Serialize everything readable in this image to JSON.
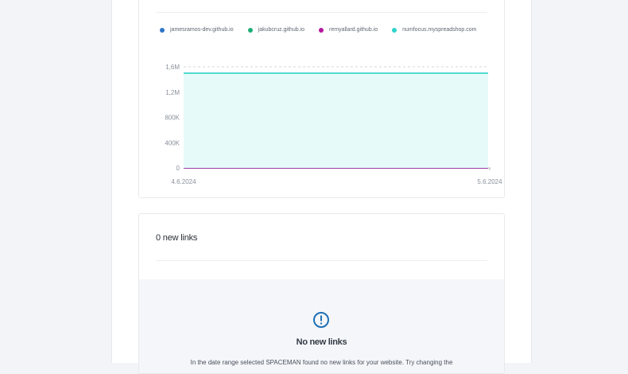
{
  "chart_data": {
    "type": "area",
    "series": [
      {
        "name": "jamesramos-dev.github.io",
        "color": "#2f74c9",
        "values": [
          0,
          0
        ]
      },
      {
        "name": "jakubcruz.github.io",
        "color": "#1fae79",
        "values": [
          0,
          0
        ]
      },
      {
        "name": "remyallard.github.io",
        "color": "#b5179e",
        "values": [
          0,
          0
        ]
      },
      {
        "name": "numfocus.myspreadshop.com",
        "color": "#2ed3c9",
        "values": [
          1500000,
          1500000
        ]
      }
    ],
    "x": [
      "4.6.2024",
      "5.6.2024"
    ],
    "yticks": [
      "0",
      "400K",
      "800K",
      "1,2M",
      "1,6M"
    ],
    "ytick_values": [
      0,
      400000,
      800000,
      1200000,
      1600000
    ],
    "ylim": [
      0,
      1600000
    ],
    "grid": true,
    "legend": "top-left"
  },
  "links": {
    "title": "0 new links",
    "empty_title": "No new links",
    "empty_text": "In the date range selected SPACEMAN found no new links for your website. Try changing the",
    "icon": "exclamation-circle-icon",
    "accent": "#1f6fb5"
  }
}
